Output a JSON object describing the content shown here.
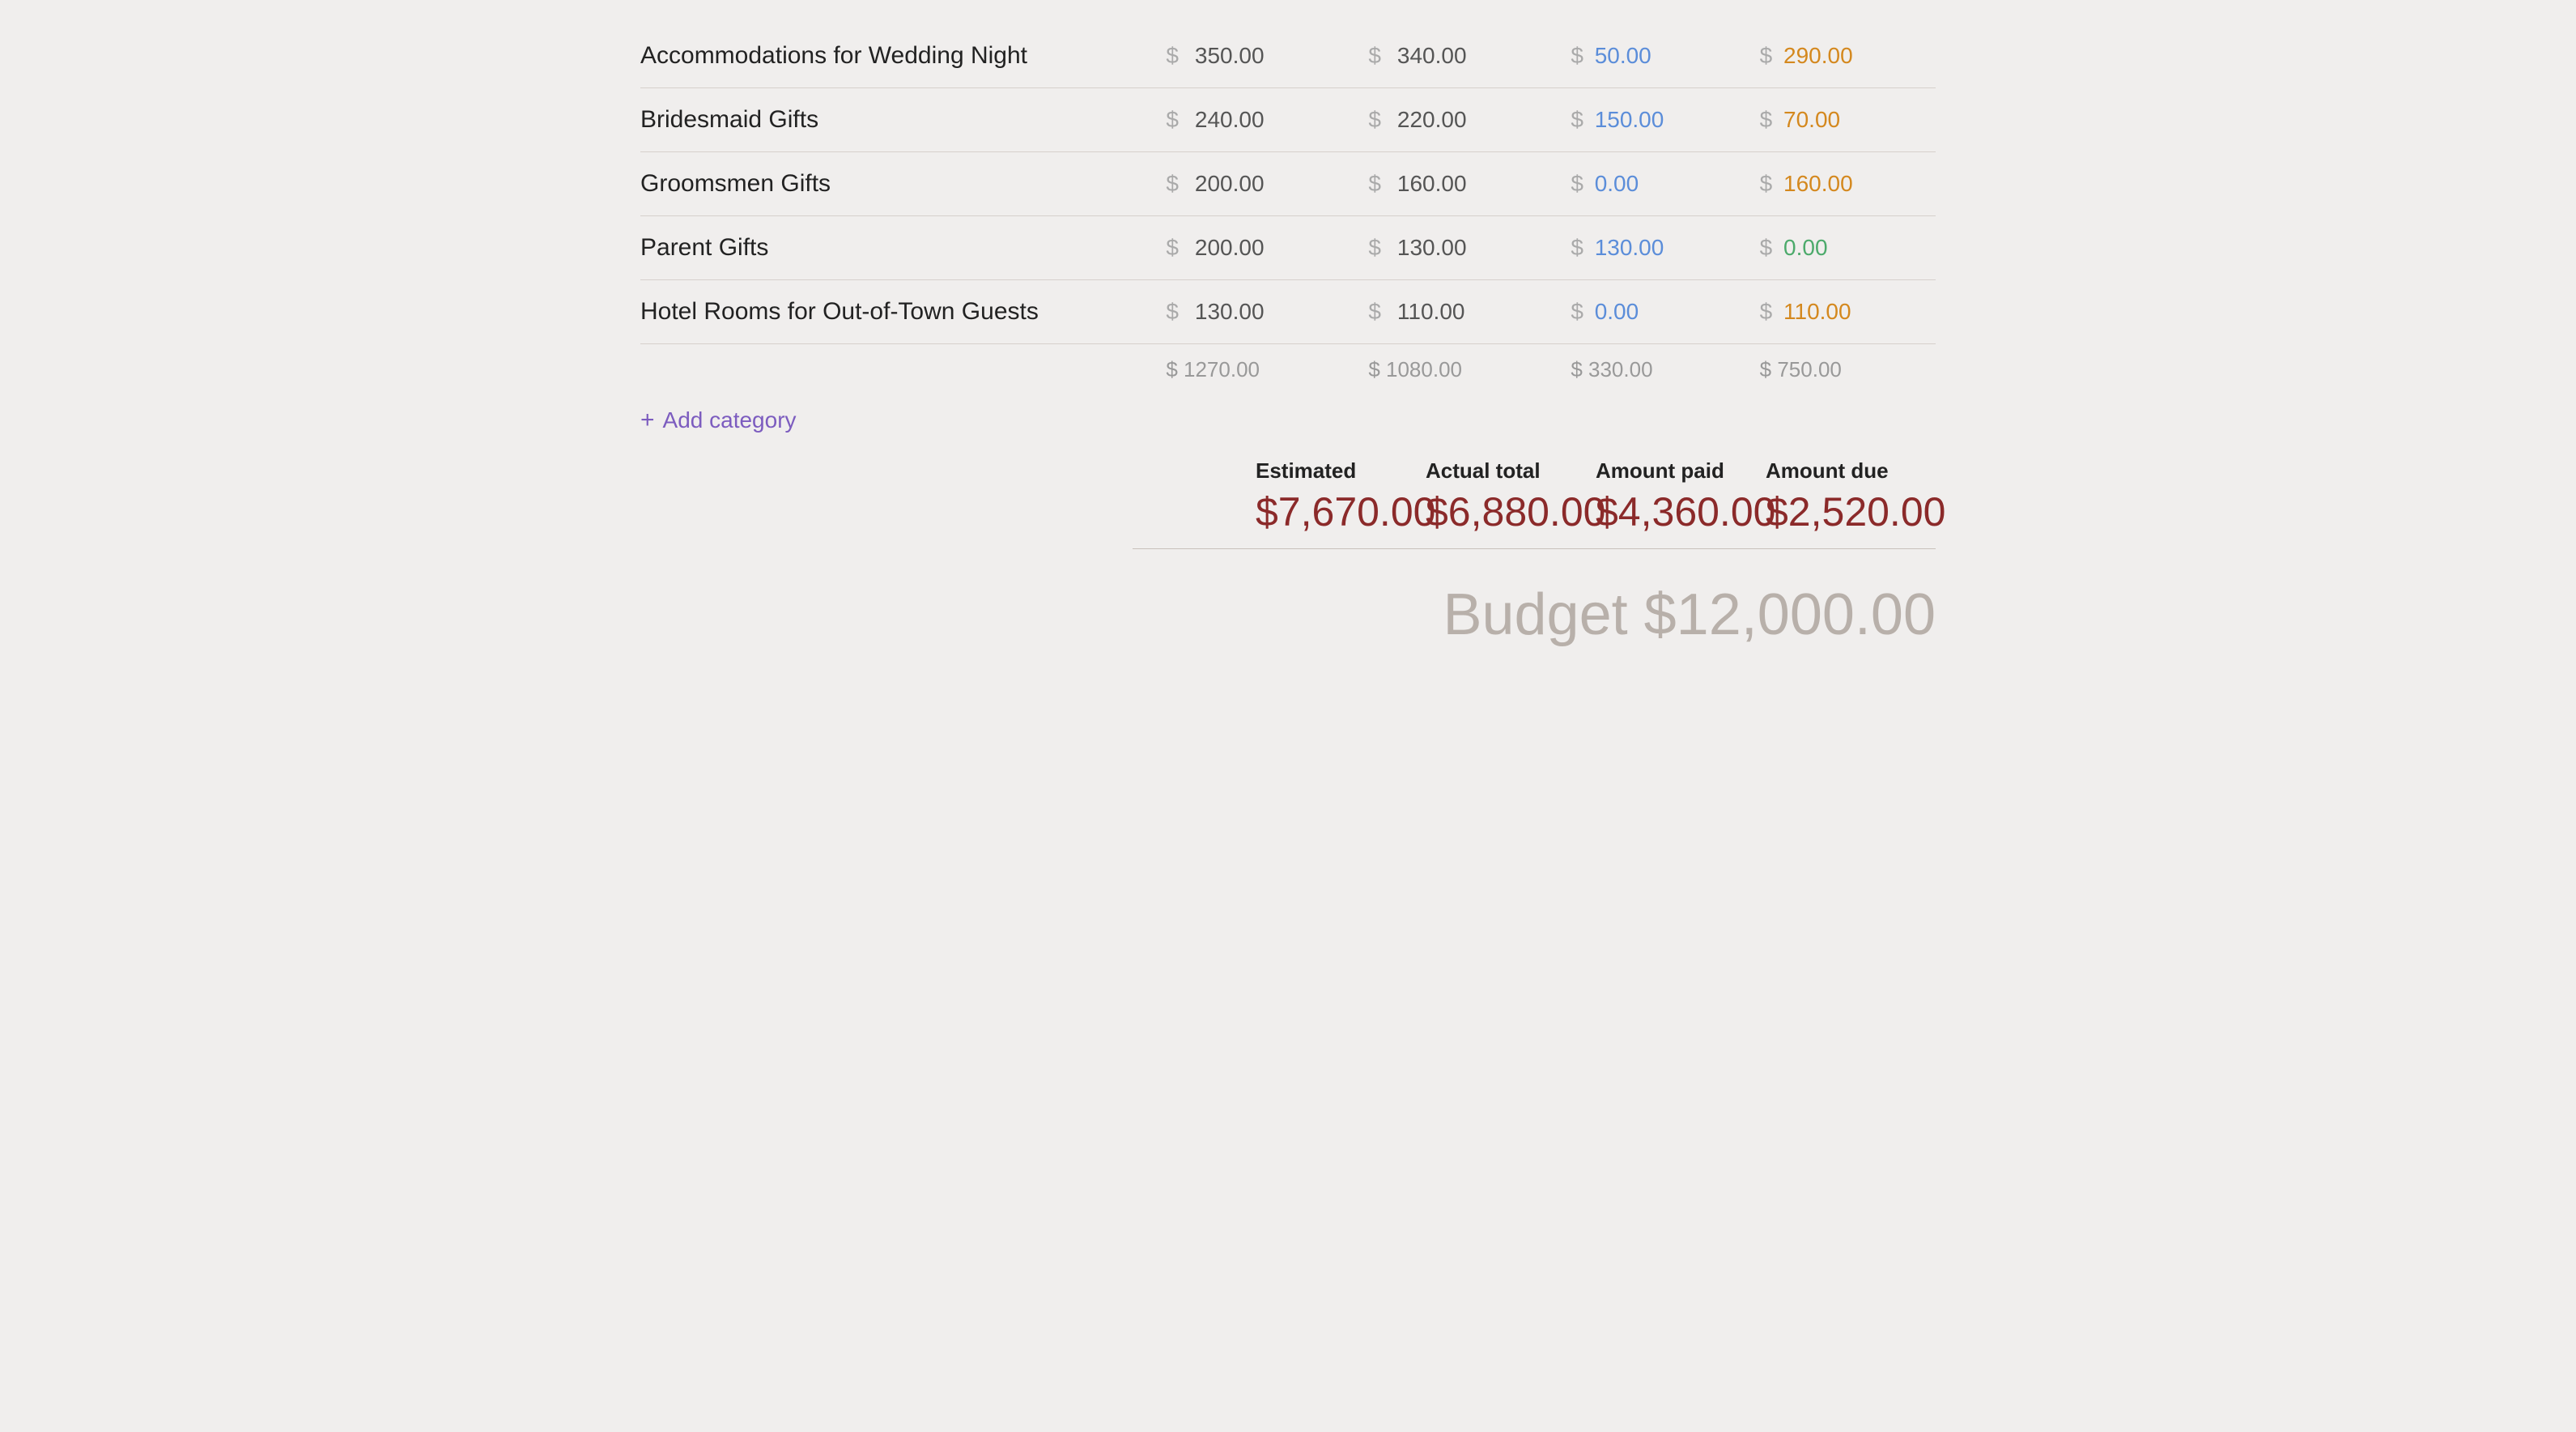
{
  "rows": [
    {
      "name": "Accommodations for Wedding Night",
      "estimated": "350.00",
      "actual": "340.00",
      "paid": "50.00",
      "due": "290.00",
      "due_color": "orange"
    },
    {
      "name": "Bridesmaid Gifts",
      "estimated": "240.00",
      "actual": "220.00",
      "paid": "150.00",
      "due": "70.00",
      "due_color": "orange"
    },
    {
      "name": "Groomsmen Gifts",
      "estimated": "200.00",
      "actual": "160.00",
      "paid": "0.00",
      "due": "160.00",
      "due_color": "orange"
    },
    {
      "name": "Parent Gifts",
      "estimated": "200.00",
      "actual": "130.00",
      "paid": "130.00",
      "due": "0.00",
      "due_color": "green"
    },
    {
      "name": "Hotel Rooms for Out-of-Town Guests",
      "estimated": "130.00",
      "actual": "110.00",
      "paid": "0.00",
      "due": "110.00",
      "due_color": "orange"
    }
  ],
  "subtotals": {
    "estimated": "$ 1270.00",
    "actual": "$ 1080.00",
    "paid": "$ 330.00",
    "due": "$ 750.00"
  },
  "add_category_label": "Add category",
  "summary": {
    "estimated_label": "Estimated",
    "estimated_value": "$7,670.00",
    "actual_label": "Actual total",
    "actual_value": "$6,880.00",
    "paid_label": "Amount paid",
    "paid_value": "$4,360.00",
    "due_label": "Amount due",
    "due_value": "$2,520.00"
  },
  "budget_label": "Budget $12,000.00",
  "colors": {
    "blue": "#5b8dd9",
    "orange": "#d4881e",
    "green": "#4caa6b",
    "muted": "#999999",
    "dark_red": "#8b2a2a",
    "purple": "#7c5cbf"
  }
}
